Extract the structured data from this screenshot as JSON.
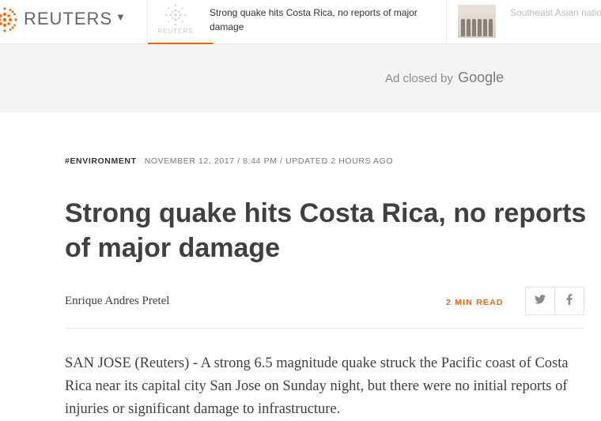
{
  "nav": {
    "logo_text": "REUTERS",
    "stories": [
      {
        "title": "Strong quake hits Costa Rica, no reports of major damage",
        "thumb_watermark": "REUTERS"
      },
      {
        "title": "Southeast Asian nations, China Sea thaw for gr"
      }
    ]
  },
  "ad": {
    "text": "Ad closed by",
    "brand": "Google"
  },
  "article": {
    "tag": "#ENVIRONMENT",
    "meta": "NOVEMBER 12, 2017 / 8:44 PM / UPDATED 2 HOURS AGO",
    "headline": "Strong quake hits Costa Rica, no reports of major damage",
    "byline": "Enrique Andres Pretel",
    "read_time": "2 MIN READ",
    "body": "SAN JOSE (Reuters) - A strong 6.5 magnitude quake struck the Pacific coast of Costa Rica near its capital city San Jose on Sunday night, but there were no initial reports of injuries or significant damage to infrastructure."
  },
  "icons": {
    "logo": "reuters-dots-icon",
    "menu": "caret-down-icon",
    "share_twitter": "twitter-icon",
    "share_facebook": "facebook-icon"
  },
  "colors": {
    "accent": "#fa6400",
    "text": "#404040",
    "muted": "#7a7a7a",
    "ad_background": "#f4f4f4"
  }
}
